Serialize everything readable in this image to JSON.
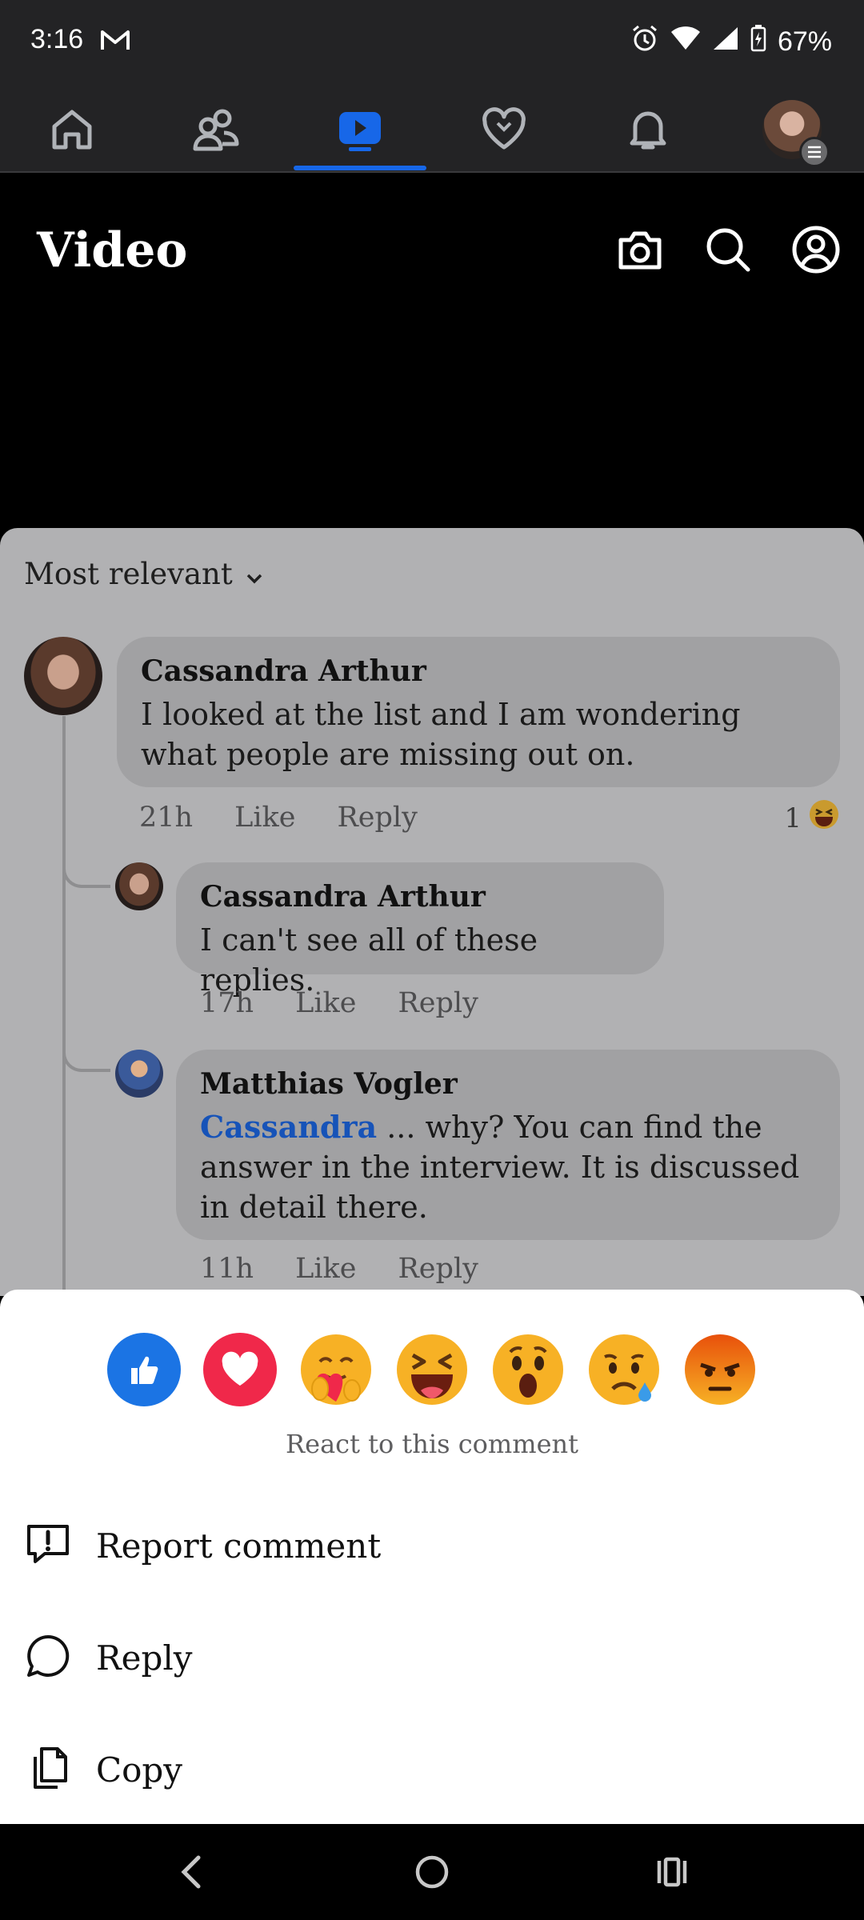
{
  "status": {
    "time": "3:16",
    "battery": "67%"
  },
  "nav": {
    "tabs": [
      "home-icon",
      "friends-icon",
      "video-icon",
      "dating-icon",
      "notifications-icon",
      "profile-icon"
    ],
    "active": "video-icon"
  },
  "header": {
    "title": "Video"
  },
  "comments": {
    "sort_label": "Most relevant",
    "items": [
      {
        "author": "Cassandra Arthur",
        "text": "I looked at the list and I am wondering what people are missing out on.",
        "time": "21h",
        "like": "Like",
        "reply": "Reply",
        "reaction_count": "1"
      },
      {
        "author": "Cassandra Arthur",
        "text": "I can't see all of these replies.",
        "time": "17h",
        "like": "Like",
        "reply": "Reply"
      },
      {
        "author": "Matthias Vogler",
        "mention": "Cassandra",
        "text": " ... why? You can find the answer in the interview. It is discussed in detail there.",
        "time": "11h",
        "like": "Like",
        "reply": "Reply"
      }
    ]
  },
  "sheet": {
    "reactions": [
      "like",
      "love",
      "care",
      "haha",
      "wow",
      "sad",
      "angry"
    ],
    "caption": "React to this comment",
    "menu": [
      {
        "label": "Report comment",
        "icon": "report-icon"
      },
      {
        "label": "Reply",
        "icon": "reply-bubble-icon"
      },
      {
        "label": "Copy",
        "icon": "copy-icon"
      }
    ]
  },
  "colors": {
    "accent": "#1767e8",
    "mention": "#1653b8",
    "like": "#1b74e4",
    "love": "#f0284a",
    "angry": "#e8500b"
  }
}
